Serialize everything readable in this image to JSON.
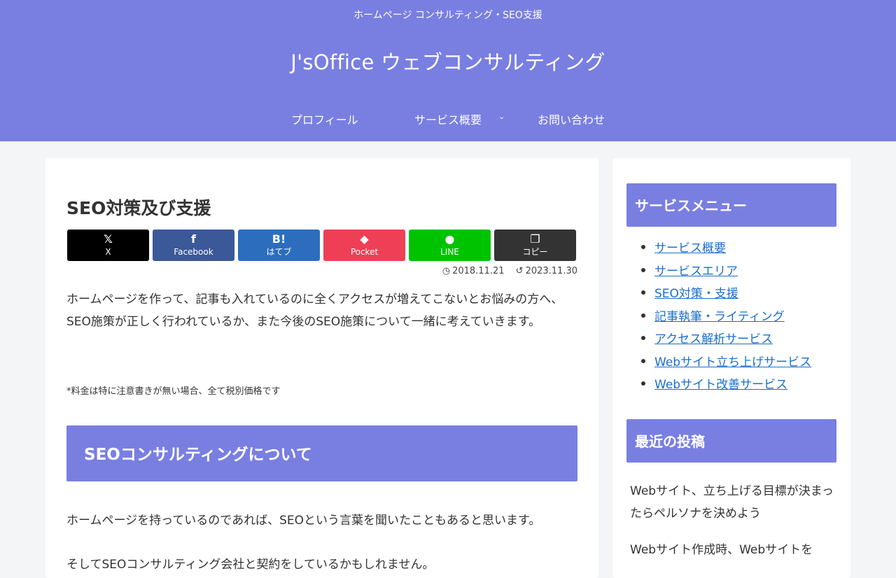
{
  "header": {
    "tagline": "ホームページ コンサルティング・SEO支援",
    "site_title": "J'sOffice ウェブコンサルティング",
    "nav": [
      {
        "label": "プロフィール"
      },
      {
        "label": "サービス概要"
      },
      {
        "label": "お問い合わせ"
      }
    ]
  },
  "article": {
    "title": "SEO対策及び支援",
    "share": [
      {
        "icon": "𝕏",
        "label": "X",
        "color": "#000000"
      },
      {
        "icon": "f",
        "label": "Facebook",
        "color": "#3b5998"
      },
      {
        "icon": "B!",
        "label": "はてブ",
        "color": "#2c6ebd"
      },
      {
        "icon": "◆",
        "label": "Pocket",
        "color": "#ef3f56"
      },
      {
        "icon": "●",
        "label": "LINE",
        "color": "#00c300"
      },
      {
        "icon": "❐",
        "label": "コピー",
        "color": "#333333"
      }
    ],
    "published": "2018.11.21",
    "updated": "2023.11.30",
    "intro": "ホームページを作って、記事も入れているのに全くアクセスが増えてこないとお悩みの方へ、SEO施策が正しく行われているか、また今後のSEO施策について一緒に考えていきます。",
    "note": "*料金は特に注意書きが無い場合、全て税別価格です",
    "h2": "SEOコンサルティングについて",
    "para1": "ホームページを持っているのであれば、SEOという言葉を聞いたこともあると思います。",
    "para2": "そしてSEOコンサルティング会社と契約をしているかもしれません。"
  },
  "sidebar": {
    "menu_heading": "サービスメニュー",
    "menu": [
      "サービス概要",
      "サービスエリア",
      "SEO対策・支援",
      "記事執筆・ライティング",
      "アクセス解析サービス",
      "Webサイト立ち上げサービス",
      "Webサイト改善サービス"
    ],
    "recent_heading": "最近の投稿",
    "recent": [
      "Webサイト、立ち上げる目標が決まったらペルソナを決めよう",
      "Webサイト作成時、Webサイトを"
    ]
  },
  "colors": {
    "brand": "#797fe1",
    "link": "#1a6fcc"
  }
}
